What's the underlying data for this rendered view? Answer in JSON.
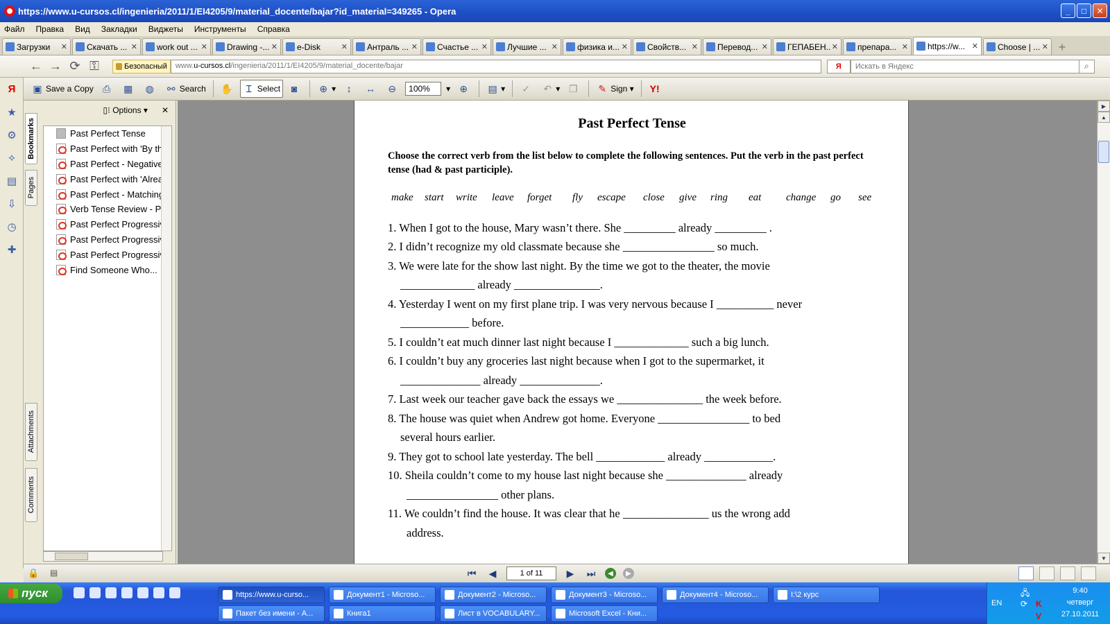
{
  "window": {
    "title": "https://www.u-cursos.cl/ingenieria/2011/1/EI4205/9/material_docente/bajar?id_material=349265 - Opera",
    "minimize": "_",
    "maximize": "□",
    "close": "✕"
  },
  "menu": [
    "Файл",
    "Правка",
    "Вид",
    "Закладки",
    "Виджеты",
    "Инструменты",
    "Справка"
  ],
  "tabs": [
    {
      "label": "Загрузки"
    },
    {
      "label": "Скачать ..."
    },
    {
      "label": "work out ..."
    },
    {
      "label": "Drawing -..."
    },
    {
      "label": "e-Disk"
    },
    {
      "label": "Антраль ..."
    },
    {
      "label": "Счастье ..."
    },
    {
      "label": "Лучшие ..."
    },
    {
      "label": "физика и..."
    },
    {
      "label": "Свойств..."
    },
    {
      "label": "Перевод..."
    },
    {
      "label": "ГЕПАБЕН..."
    },
    {
      "label": "препара..."
    },
    {
      "label": "https://w..."
    },
    {
      "label": "Choose | ..."
    }
  ],
  "address": {
    "security_label": "Безопасный",
    "url_host_prefix": "www.",
    "url_host": "u-cursos.cl",
    "url_path": "/ingenieria/2011/1/EI4205/9/material_docente/bajar",
    "search_engine": "Я",
    "search_placeholder": "Искать в Яндекс"
  },
  "pdf_toolbar": {
    "save_copy": "Save a Copy",
    "search": "Search",
    "select": "Select",
    "zoom": "100%",
    "sign": "Sign"
  },
  "bookmarks": {
    "options_label": "Options",
    "tabs": [
      "Bookmarks",
      "Pages",
      "Attachments",
      "Comments"
    ],
    "items": [
      "Past Perfect Tense",
      "Past Perfect with 'By the time'",
      "Past Perfect - Negative",
      "Past Perfect with 'Already'",
      "Past Perfect - Matching",
      "Verb Tense Review - Past",
      "Past Perfect Progressive",
      "Past Perfect Progressive",
      "Past Perfect Progressive",
      "Find Someone Who..."
    ]
  },
  "document": {
    "title": "Past Perfect Tense",
    "instructions": "Choose the correct verb from the list below to complete the following sentences. Put the verb in the past perfect tense (had & past participle).",
    "word_bank": [
      "make",
      "start",
      "write",
      "leave",
      "forget",
      "fly",
      "escape",
      "close",
      "give",
      "ring",
      "eat",
      "change",
      "go",
      "see"
    ],
    "lines": [
      "1. When I got to the house, Mary wasn’t there. She _________ already _________ .",
      "2. I didn’t recognize my old classmate because she ________________ so much.",
      "3. We were late for the show last night. By the time we got to the theater, the movie",
      "_____________ already _______________.",
      "4. Yesterday I went on my first plane trip. I was very nervous because I __________ never",
      "____________ before.",
      "5. I couldn’t eat much dinner last night because I _____________ such a big lunch.",
      "6. I couldn’t buy any groceries last night because when I got to the supermarket, it",
      "______________ already ______________.",
      "7. Last week our teacher gave back the essays we _______________ the week before.",
      "8. The house was quiet when Andrew got home. Everyone ________________ to bed",
      "several hours earlier.",
      "9. They got to school late yesterday. The bell ____________ already ____________.",
      "10. Sheila couldn’t come to my house last night because she ______________ already",
      "________________ other plans.",
      "11. We couldn’t find the house. It was clear that he _______________ us the wrong add",
      "address."
    ]
  },
  "status": {
    "page_indicator": "1 of 11"
  },
  "taskbar": {
    "start_label": "пуск",
    "buttons_row1": [
      "https://www.u-curso...",
      "Документ1 - Microso...",
      "Документ2 - Microso...",
      "Документ3 - Microso...",
      "Документ4 - Microso...",
      "I:\\2 курс"
    ],
    "buttons_row2": [
      "Пакет без имени - А...",
      "Книга1",
      "Лист в VOCABULARY...",
      "Microsoft Excel - Кни..."
    ],
    "lang": "EN",
    "time": "9:40",
    "weekday": "четверг",
    "date": "27.10.2011"
  }
}
